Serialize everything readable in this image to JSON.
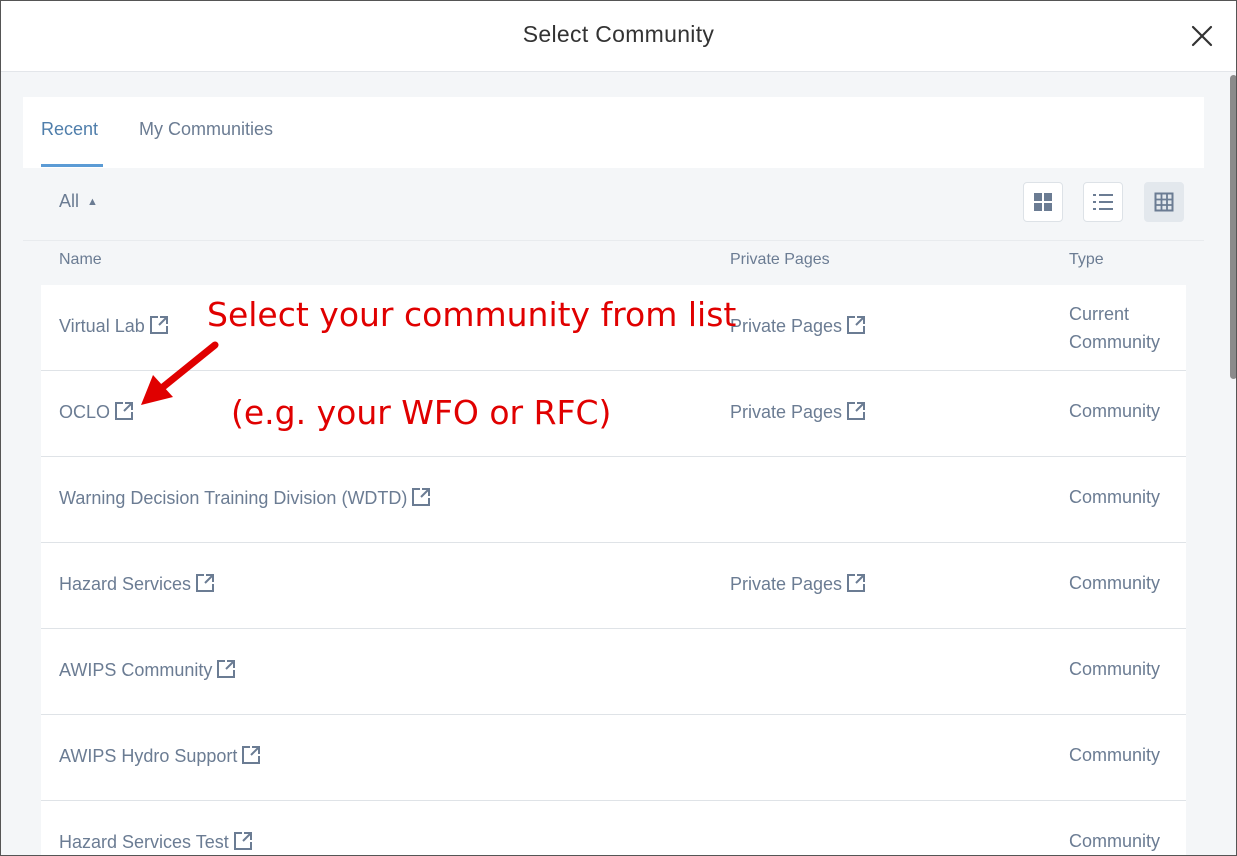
{
  "dialog": {
    "title": "Select Community"
  },
  "tabs": [
    {
      "label": "Recent",
      "active": true
    },
    {
      "label": "My Communities",
      "active": false
    }
  ],
  "filter": {
    "selected": "All"
  },
  "view_modes": [
    "cards-icon",
    "list-icon",
    "table-icon"
  ],
  "active_view": "table",
  "table": {
    "headers": {
      "name": "Name",
      "private_pages": "Private Pages",
      "type": "Type"
    },
    "rows": [
      {
        "name": "Virtual Lab",
        "private_pages": "Private Pages",
        "type": "Current Community"
      },
      {
        "name": "OCLO",
        "private_pages": "Private Pages",
        "type": "Community"
      },
      {
        "name": "Warning Decision Training Division (WDTD)",
        "private_pages": "",
        "type": "Community"
      },
      {
        "name": "Hazard Services",
        "private_pages": "Private Pages",
        "type": "Community"
      },
      {
        "name": "AWIPS Community",
        "private_pages": "",
        "type": "Community"
      },
      {
        "name": "AWIPS Hydro Support",
        "private_pages": "",
        "type": "Community"
      },
      {
        "name": "Hazard Services Test",
        "private_pages": "",
        "type": "Community"
      }
    ]
  },
  "annotation": {
    "line1": "Select your community from list",
    "line2": "(e.g. your WFO or RFC)"
  },
  "colors": {
    "accent": "#5b9bd5",
    "text_muted": "#6b7c93",
    "annotation_red": "#e00000",
    "body_bg": "#f4f6f8"
  }
}
